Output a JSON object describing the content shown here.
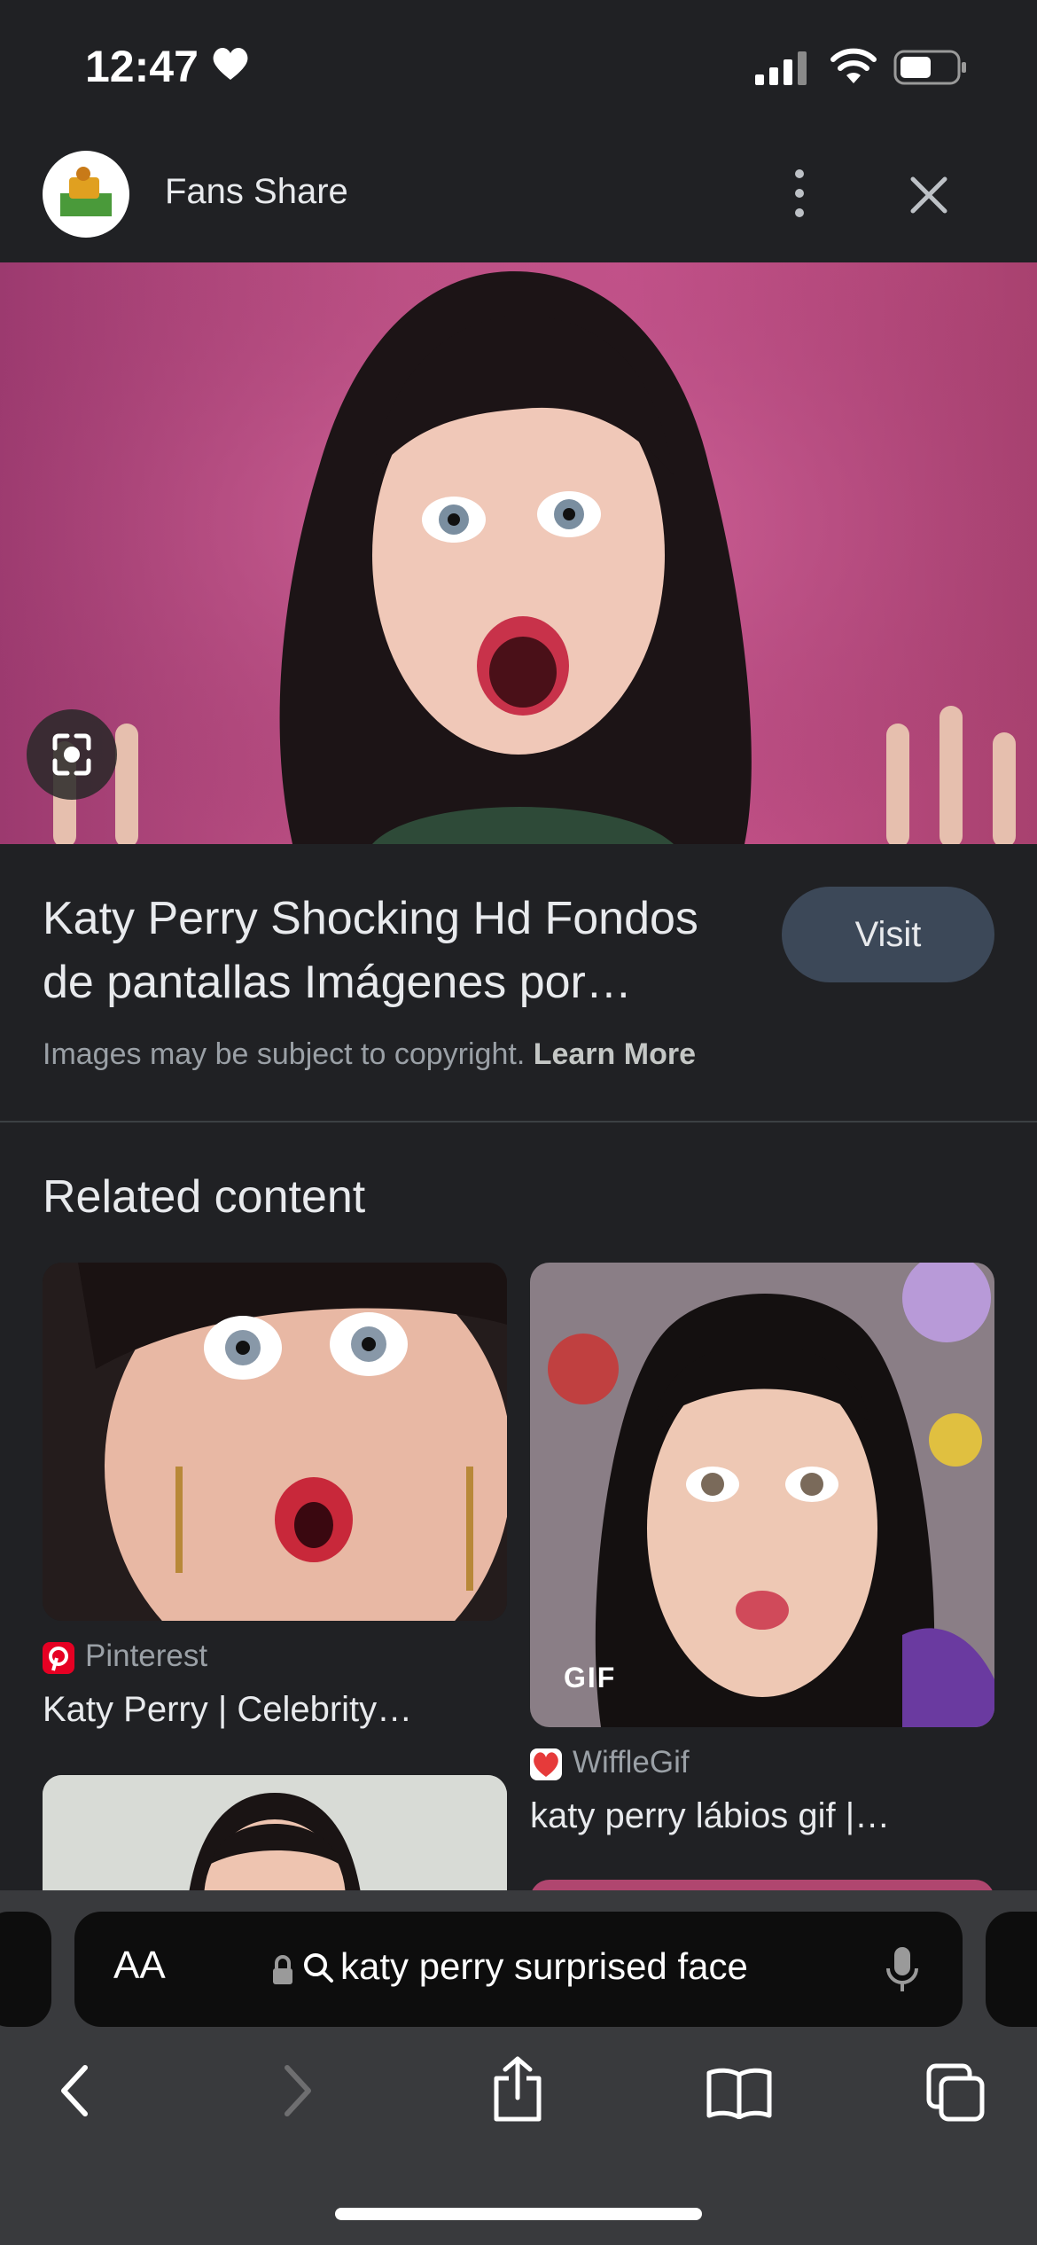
{
  "status_bar": {
    "time": "12:47"
  },
  "header": {
    "site_name": "Fans Share"
  },
  "result": {
    "title": "Katy Perry Shocking Hd Fondos de pantallas Imágenes por…",
    "visit_label": "Visit",
    "copyright_text": "Images may be subject to copyright.",
    "learn_more": "Learn More"
  },
  "related": {
    "heading": "Related content",
    "items": [
      {
        "source": "Pinterest",
        "caption": "Katy Perry | Celebrity…"
      },
      {
        "source": "WiffleGif",
        "caption": "katy perry lábios gif |…",
        "badge": "GIF"
      }
    ]
  },
  "toolbar": {
    "aa_label": "AA",
    "url_text": "katy perry surprised face"
  },
  "colors": {
    "background": "#202124",
    "visit_button": "#3c4858",
    "hero_backdrop": "#c35488",
    "toolbar": "#393a3d"
  }
}
